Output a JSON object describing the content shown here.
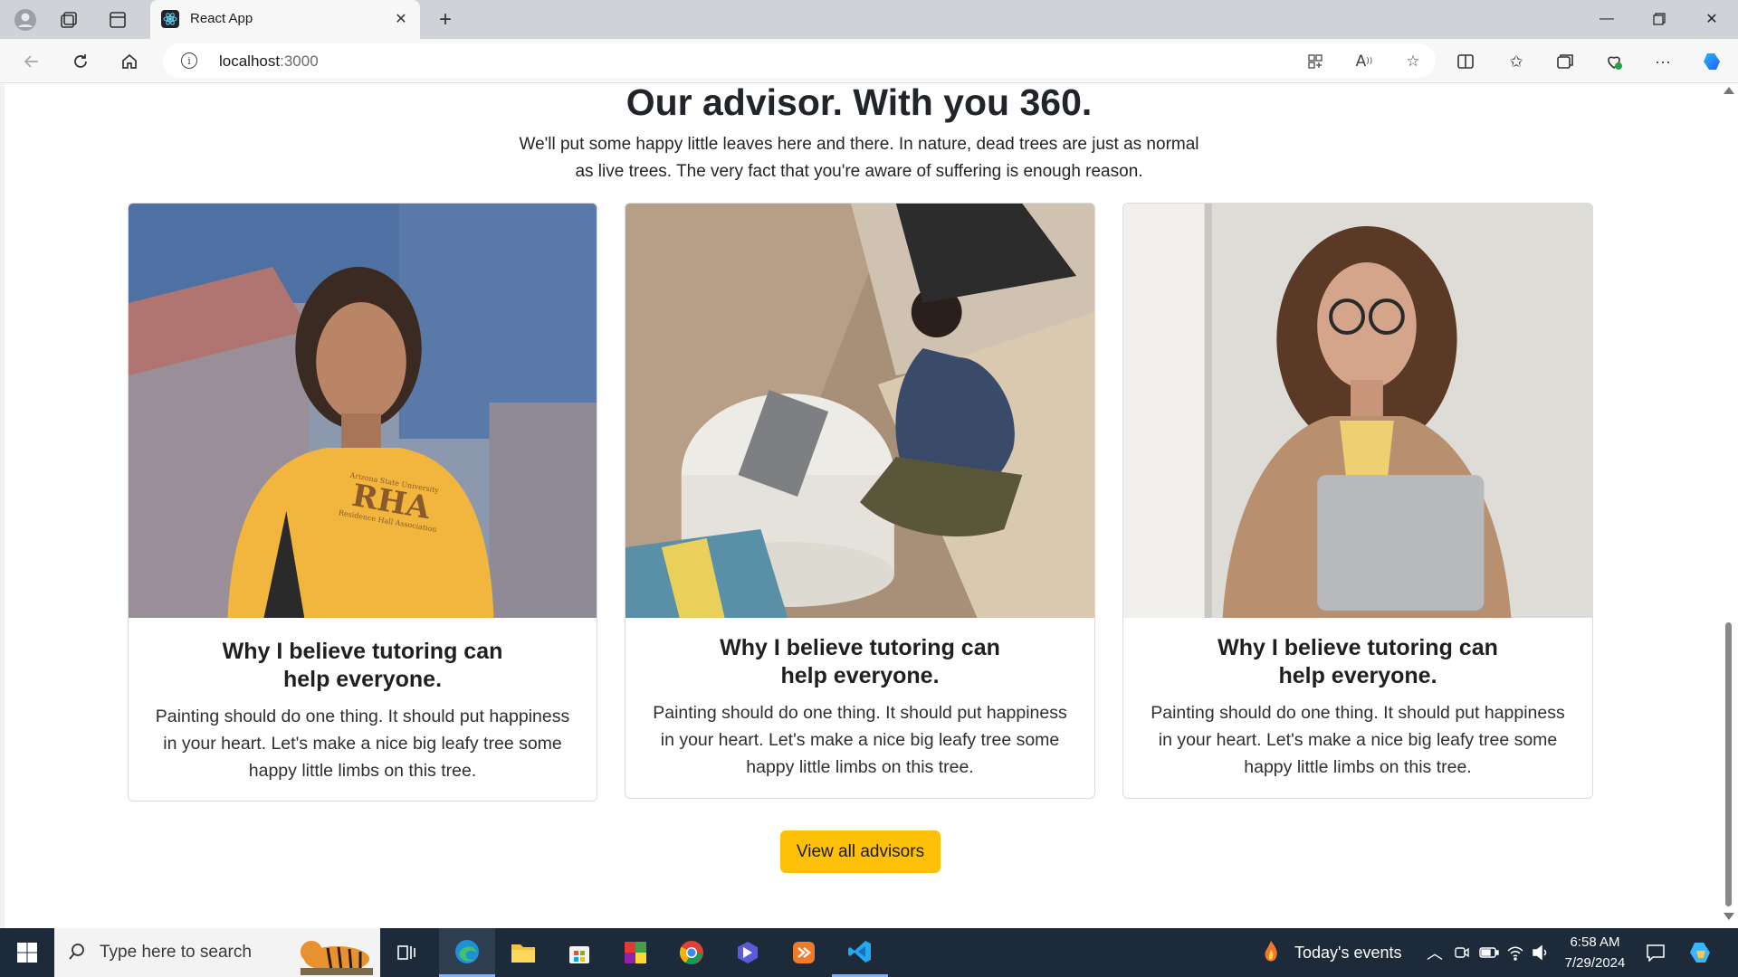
{
  "browser": {
    "tab_title": "React App",
    "tab_close_icon": "close-icon",
    "new_tab_icon": "plus-icon",
    "address": "localhost",
    "address_port": ":3000",
    "window_controls": [
      "minimize-icon",
      "restore-icon",
      "close-icon"
    ]
  },
  "page": {
    "heading": "Our advisor. With you 360.",
    "subtext_line1": "We'll put some happy little leaves here and there. In nature, dead trees are just as normal",
    "subtext_line2": "as live trees. The very fact that you're aware of suffering is enough reason.",
    "cards": [
      {
        "title_line1": "Why I believe tutoring can",
        "title_line2": "help everyone.",
        "text_line1": "Painting should do one thing. It should put happiness",
        "text_line2": "in your heart. Let's make a nice big leafy tree some",
        "text_line3": "happy little limbs on this tree.",
        "shirt_text_small": "Arizona State University",
        "shirt_text_big": "RHA",
        "shirt_text_sub": "Residence Hall Association"
      },
      {
        "title_line1": "Why I believe tutoring can",
        "title_line2": "help everyone.",
        "text_line1": "Painting should do one thing. It should put happiness",
        "text_line2": "in your heart. Let's make a nice big leafy tree some",
        "text_line3": "happy little limbs on this tree."
      },
      {
        "title_line1": "Why I believe tutoring can",
        "title_line2": "help everyone.",
        "text_line1": "Painting should do one thing. It should put happiness",
        "text_line2": "in your heart. Let's make a nice big leafy tree some",
        "text_line3": "happy little limbs on this tree."
      }
    ],
    "button_label": "View all advisors",
    "accent_color": "#ffc107"
  },
  "taskbar": {
    "search_placeholder": "Type here to search",
    "events_label": "Today's events",
    "time": "6:58 AM",
    "date": "7/29/2024"
  }
}
